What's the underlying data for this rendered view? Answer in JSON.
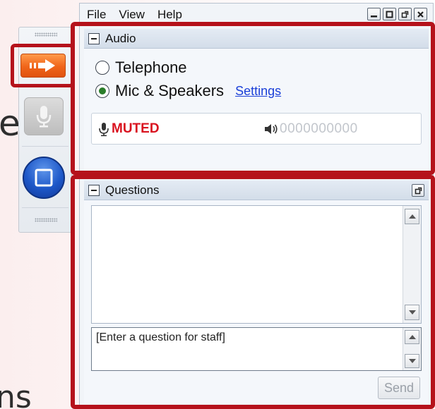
{
  "background": {
    "fragment_1": "e",
    "fragment_2": "ns"
  },
  "menu": {
    "items": [
      "File",
      "View",
      "Help"
    ]
  },
  "audio_panel": {
    "title": "Audio",
    "options": [
      "Telephone",
      "Mic & Speakers"
    ],
    "selected_option": "Mic & Speakers",
    "settings_link": "Settings",
    "status": "MUTED",
    "level_meter": "0000000000"
  },
  "questions_panel": {
    "title": "Questions",
    "input_placeholder": "[Enter a question for staff]",
    "send_label": "Send"
  },
  "colors": {
    "highlight": "#b5121b",
    "muted_red": "#d9121f",
    "link_blue": "#1a3fd8",
    "arrow_orange": "#f0651a",
    "stop_blue": "#1d57c8"
  },
  "icons": {
    "arrow": "arrow-right-icon",
    "mic": "microphone-icon",
    "stop": "stop-icon",
    "speaker": "speaker-icon",
    "collapse": "minus-icon",
    "popout": "popout-icon"
  }
}
